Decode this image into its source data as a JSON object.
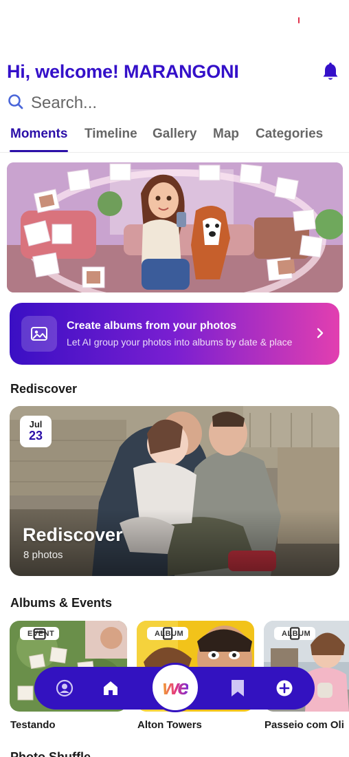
{
  "header": {
    "greeting": "Hi, welcome! MARANGONI",
    "icons": {
      "notifications": "bell-icon"
    }
  },
  "search": {
    "placeholder": "Search...",
    "icon": "search-icon"
  },
  "tabs": [
    {
      "label": "Moments",
      "active": true
    },
    {
      "label": "Timeline",
      "active": false
    },
    {
      "label": "Gallery",
      "active": false
    },
    {
      "label": "Map",
      "active": false
    },
    {
      "label": "Categories",
      "active": false
    }
  ],
  "promo": {
    "title": "Create albums from your photos",
    "subtitle": "Let AI group your photos into albums by date & place",
    "icon": "image-icon"
  },
  "rediscover": {
    "section_title": "Rediscover",
    "card": {
      "date_month": "Jul",
      "date_day": "23",
      "title": "Rediscover",
      "subtitle": "8 photos"
    }
  },
  "albums": {
    "section_title": "Albums & Events",
    "items": [
      {
        "tag": "EVENT",
        "tag_icon": "calendar-icon",
        "name": "Testando"
      },
      {
        "tag": "ALBUM",
        "tag_icon": "album-icon",
        "name": "Alton Towers"
      },
      {
        "tag": "ALBUM",
        "tag_icon": "album-icon",
        "name": "Passeio com Oli"
      }
    ]
  },
  "next_section": {
    "title": "Photo Shuffle"
  },
  "bottom_nav": {
    "items": [
      "profile-icon",
      "home-icon",
      "we-logo",
      "bookmark-icon",
      "add-icon"
    ],
    "center_logo_text": "we"
  },
  "colors": {
    "brand": "#3312c0",
    "accent": "#2b0fa8",
    "promo_gradient_start": "#3a0fc4",
    "promo_gradient_end": "#e23fb0"
  }
}
